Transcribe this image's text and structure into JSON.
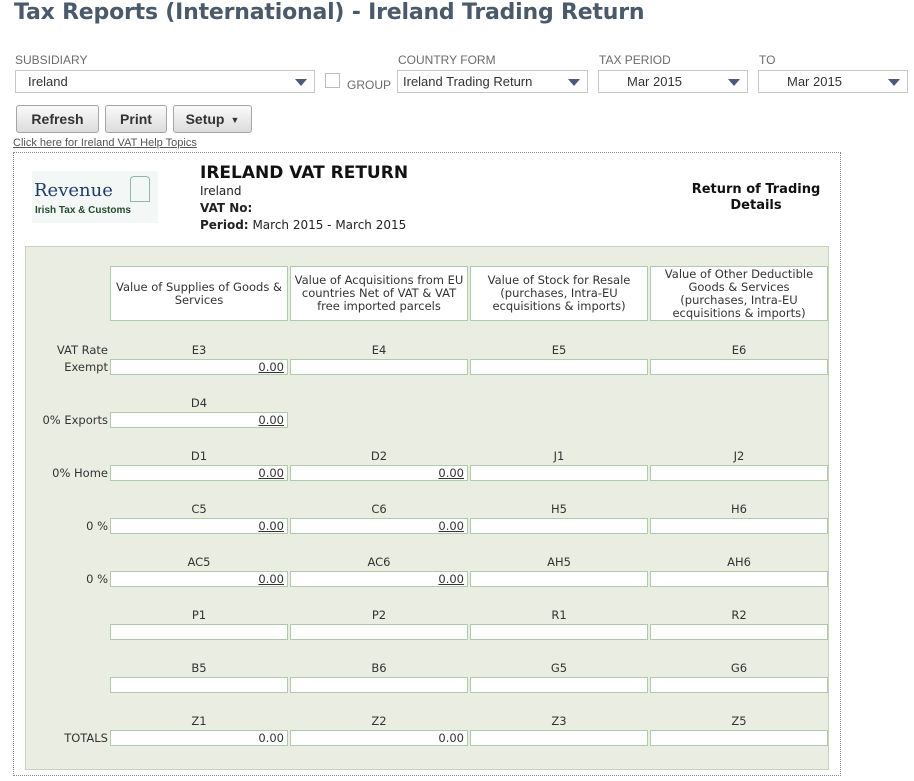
{
  "page": {
    "title": "Tax Reports (International) - Ireland Trading Return"
  },
  "filters": {
    "subsidiary": {
      "label": "SUBSIDIARY",
      "value": "Ireland"
    },
    "group": {
      "label": "GROUP"
    },
    "country_form": {
      "label": "COUNTRY FORM",
      "value": "Ireland Trading Return"
    },
    "tax_period": {
      "label": "TAX PERIOD",
      "value": "Mar 2015"
    },
    "to": {
      "label": "TO",
      "value": "Mar 2015"
    }
  },
  "buttons": {
    "refresh": "Refresh",
    "print": "Print",
    "setup": "Setup"
  },
  "help_link": "Click here for Ireland VAT Help Topics",
  "report": {
    "logo": {
      "name": "Revenue",
      "sub": "Irish Tax & Customs",
      "icon": "harp-icon"
    },
    "title": "IRELAND VAT RETURN",
    "country": "Ireland",
    "vat_no_label": "VAT No:",
    "period_label": "Period:",
    "period_value": "March 2015 - March 2015",
    "right_title_1": "Return of Trading",
    "right_title_2": "Details",
    "columns": [
      "Value of Supplies of Goods & Services",
      "Value of Acquisitions from EU countries Net of VAT & VAT free imported parcels",
      "Value of Stock for Resale (purchases, Intra-EU ecquisitions & imports)",
      "Value of Other Deductible Goods & Services (purchases, Intra-EU ecquisitions & imports)"
    ],
    "vat_rate_label": "VAT Rate",
    "rows": {
      "exempt": {
        "label": "Exempt",
        "codes": [
          "E3",
          "E4",
          "E5",
          "E6"
        ],
        "values": [
          "0.00",
          "",
          "",
          ""
        ]
      },
      "exports": {
        "label": "0% Exports",
        "codes": [
          "D4"
        ],
        "values": [
          "0.00"
        ]
      },
      "home": {
        "label": "0% Home",
        "codes": [
          "D1",
          "D2",
          "J1",
          "J2"
        ],
        "values": [
          "0.00",
          "0.00",
          "",
          ""
        ]
      },
      "zero1": {
        "label": "0 %",
        "codes": [
          "C5",
          "C6",
          "H5",
          "H6"
        ],
        "values": [
          "0.00",
          "0.00",
          "",
          ""
        ]
      },
      "zero2": {
        "label": "0 %",
        "codes": [
          "AC5",
          "AC6",
          "AH5",
          "AH6"
        ],
        "values": [
          "0.00",
          "0.00",
          "",
          ""
        ]
      },
      "p": {
        "label": "",
        "codes": [
          "P1",
          "P2",
          "R1",
          "R2"
        ],
        "values": [
          "",
          "",
          "",
          ""
        ]
      },
      "b": {
        "label": "",
        "codes": [
          "B5",
          "B6",
          "G5",
          "G6"
        ],
        "values": [
          "",
          "",
          "",
          ""
        ]
      },
      "totals": {
        "label": "TOTALS",
        "codes": [
          "Z1",
          "Z2",
          "Z3",
          "Z5"
        ],
        "values": [
          "0.00",
          "0.00",
          "",
          ""
        ]
      }
    }
  }
}
